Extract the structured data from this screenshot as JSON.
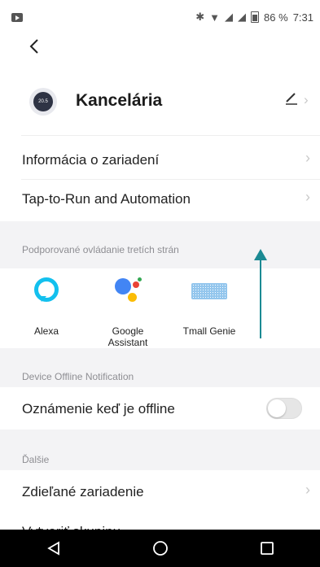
{
  "status_bar": {
    "battery_percent": "86 %",
    "time": "7:31",
    "icons": [
      "cast-icon",
      "bluetooth-icon",
      "wifi-icon",
      "signal-icon",
      "signal-icon",
      "battery-icon"
    ]
  },
  "device": {
    "name": "Kancelária",
    "icon_text": "20.5"
  },
  "rows": {
    "device_info": "Informácia o zariadení",
    "tap_to_run": "Tap-to-Run and Automation"
  },
  "third_party": {
    "title": "Podporované ovládanie tretích strán",
    "items": [
      {
        "label": "Alexa"
      },
      {
        "label": "Google\nAssistant"
      },
      {
        "label": "Tmall Genie"
      }
    ]
  },
  "offline": {
    "section_title": "Device Offline Notification",
    "row_label": "Oznámenie keď je offline",
    "enabled": false
  },
  "other": {
    "section_title": "Ďalšie",
    "shared_device": "Zdieľané zariadenie",
    "partial_next": "Vytvoriť skupinu"
  },
  "colors": {
    "annotation_arrow": "#1b8a93",
    "alexa": "#13c0ee"
  }
}
